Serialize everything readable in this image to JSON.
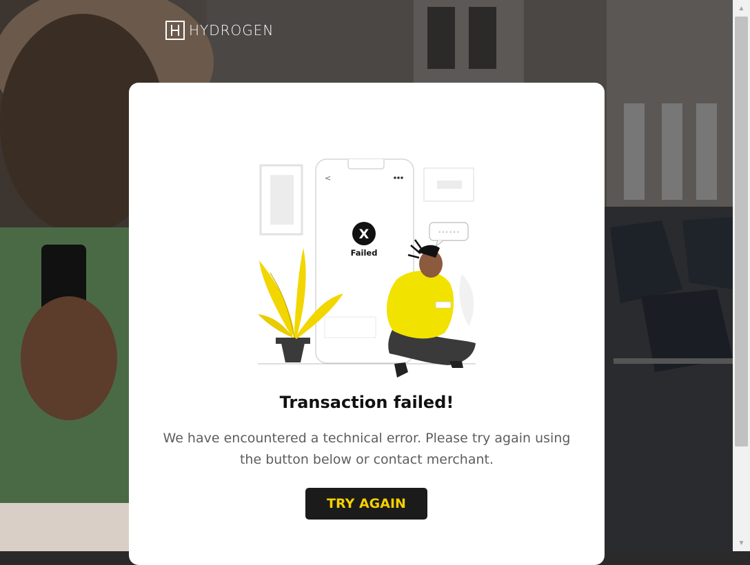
{
  "brand": {
    "name": "HYDROGEN"
  },
  "illustration": {
    "status_label": "Failed",
    "status_symbol": "X"
  },
  "dialog": {
    "title": "Transaction failed!",
    "message": "We have encountered a technical error. Please try again using the button below or contact merchant.",
    "try_again_label": "TRY AGAIN"
  },
  "colors": {
    "accent": "#f6d000",
    "button_bg": "#1b1b1b",
    "text_muted": "#5d5d5d"
  },
  "icons": {
    "scroll_up": "scroll-up-arrow-icon",
    "scroll_down": "scroll-down-arrow-icon"
  }
}
